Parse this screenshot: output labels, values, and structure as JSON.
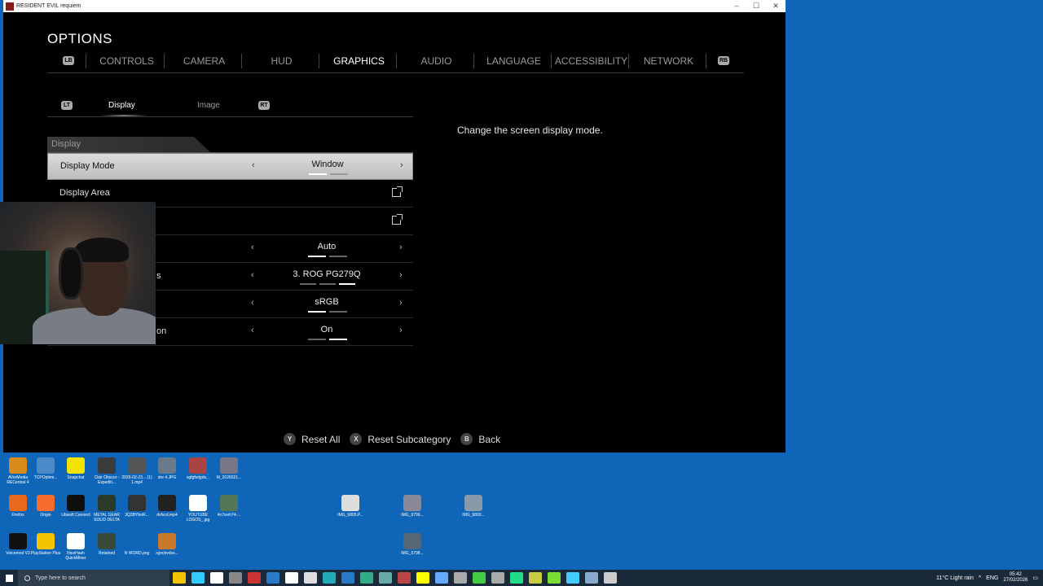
{
  "window": {
    "title": "RESIDENT EVIL requiem",
    "minimize": "–",
    "maximize": "☐",
    "close": "✕"
  },
  "options_title": "OPTIONS",
  "tabs": {
    "left_bumper": "LB",
    "right_bumper": "RB",
    "items": [
      "CONTROLS",
      "CAMERA",
      "HUD",
      "GRAPHICS",
      "AUDIO",
      "LANGUAGE",
      "ACCESSIBILITY",
      "NETWORK"
    ],
    "active": "GRAPHICS"
  },
  "subtabs": {
    "left_trigger": "LT",
    "right_trigger": "RT",
    "items": [
      "Display",
      "Image"
    ],
    "active": "Display"
  },
  "section_header": "Display",
  "rows": [
    {
      "label": "Display Mode",
      "value": "Window"
    },
    {
      "label": "Display Area"
    },
    {
      "label": ""
    },
    {
      "label": "",
      "value": "Auto"
    },
    {
      "label": "s",
      "value": "3. ROG PG279Q"
    },
    {
      "label": "",
      "value": "sRGB"
    },
    {
      "label": "on",
      "value": "On"
    }
  ],
  "description": "Change the screen display mode.",
  "footer": [
    {
      "key": "Y",
      "label": "Reset All"
    },
    {
      "key": "X",
      "label": "Reset Subcategory"
    },
    {
      "key": "B",
      "label": "Back"
    }
  ],
  "desktop_icons": [
    {
      "label": "AVerMedia RECentral 4",
      "color": "#d88a1a"
    },
    {
      "label": "TCPOptimi...",
      "color": "#4a8ac8"
    },
    {
      "label": "Snapchat",
      "color": "#f5e400"
    },
    {
      "label": "Clair Obscur - Expediti...",
      "color": "#3c3c3c"
    },
    {
      "label": "2026-02-23... (1) 1.mp4",
      "color": "#555"
    },
    {
      "label": "dre 4.JPG",
      "color": "#6a7a8a"
    },
    {
      "label": "sgfgfsdgds...",
      "color": "#a44"
    },
    {
      "label": "M_2026021...",
      "color": "#778"
    },
    {
      "label": "Firefox",
      "color": "#e66a1a"
    },
    {
      "label": "Origin",
      "color": "#f56c2d"
    },
    {
      "label": "Ubisoft Connect",
      "color": "#0f0f0f"
    },
    {
      "label": "METAL GEAR SOLID DELTA",
      "color": "#2b3a2b"
    },
    {
      "label": "3Q3BYboR...",
      "color": "#333"
    },
    {
      "label": "dvfvcd.mp4",
      "color": "#222"
    },
    {
      "label": "YOUTUBE LOGOS_.jpg",
      "color": "#fff"
    },
    {
      "label": "4n7wvh74-...",
      "color": "#575"
    },
    {
      "label": "IMG_6805.P...",
      "color": "#ddd"
    },
    {
      "label": "IMG_6799...",
      "color": "#889"
    },
    {
      "label": "IMG_6800...",
      "color": "#89a"
    },
    {
      "label": "Voicemod V3",
      "color": "#111"
    },
    {
      "label": "PlayStation Plus",
      "color": "#f5c400"
    },
    {
      "label": "NiceHash QuickMiner",
      "color": "#fff"
    },
    {
      "label": "Retained",
      "color": "#3a4a3a"
    },
    {
      "label": "N WORD.png",
      "color": "#0f66b8"
    },
    {
      "label": "xgvcbvdss...",
      "color": "#c87a2a"
    },
    {
      "label": "IMG_6798...",
      "color": "#567"
    }
  ],
  "taskbar": {
    "search_placeholder": "Type here to search",
    "weather": "11°C  Light rain",
    "lang": "ENG",
    "time": "05:42",
    "date": "27/02/2026",
    "apps": [
      "#f5c400",
      "#3cf",
      "#fff",
      "#888",
      "#c33",
      "#2a7ac8",
      "#fff",
      "#ddd",
      "#2ab",
      "#2a7ac8",
      "#3a8",
      "#6aa",
      "#b44",
      "#ff0",
      "#6af",
      "#aaa",
      "#4c4",
      "#aaa",
      "#2d8",
      "#cc4",
      "#7d3",
      "#4cf",
      "#8ac",
      "#ccc"
    ]
  }
}
